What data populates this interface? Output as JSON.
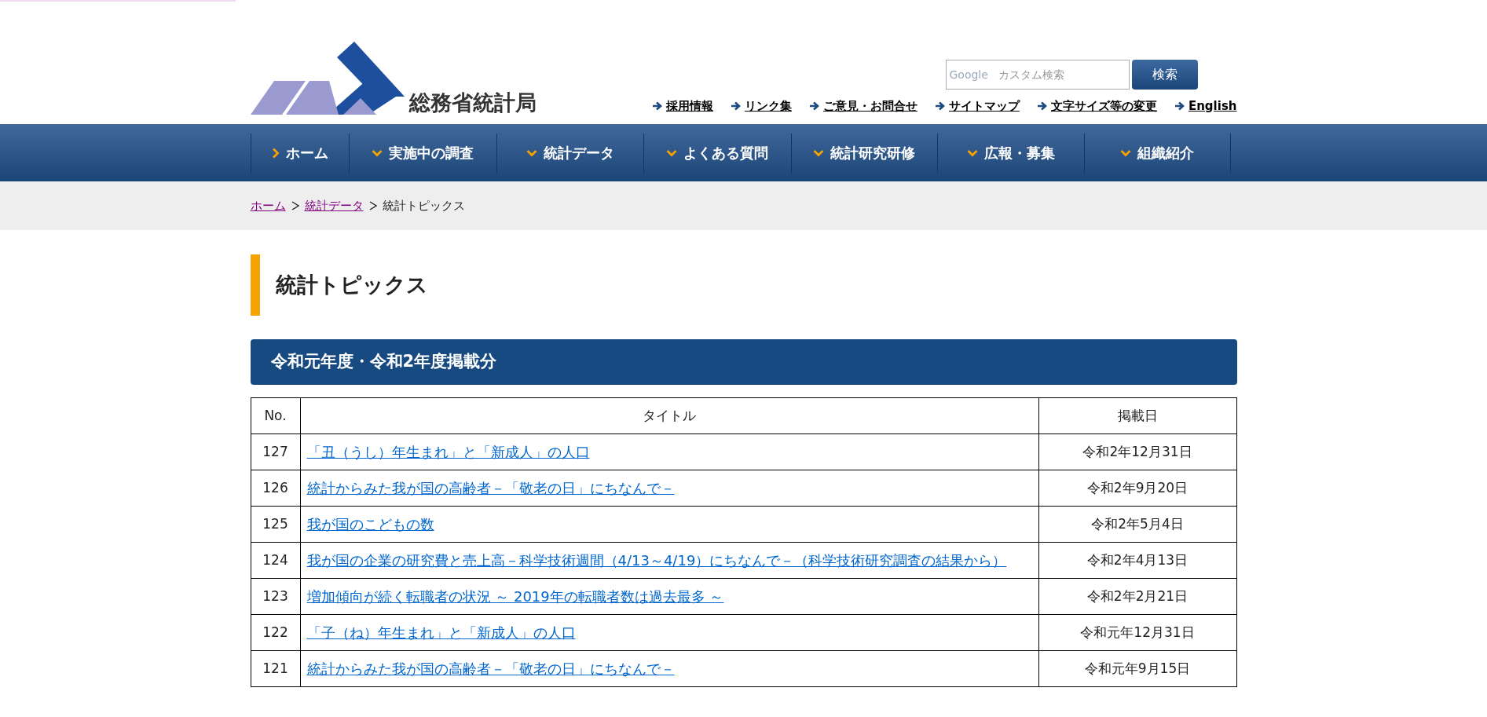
{
  "header": {
    "site_name": "総務省統計局",
    "search": {
      "brand": "Google",
      "placeholder": "カスタム検索",
      "button": "検索"
    },
    "utility_links": [
      "採用情報",
      "リンク集",
      "ご意見・お問合せ",
      "サイトマップ",
      "文字サイズ等の変更",
      "English"
    ]
  },
  "nav": [
    {
      "label": "ホーム",
      "kind": "link"
    },
    {
      "label": "実施中の調査",
      "kind": "menu"
    },
    {
      "label": "統計データ",
      "kind": "menu"
    },
    {
      "label": "よくある質問",
      "kind": "menu"
    },
    {
      "label": "統計研究研修",
      "kind": "menu"
    },
    {
      "label": "広報・募集",
      "kind": "menu"
    },
    {
      "label": "組織紹介",
      "kind": "menu"
    }
  ],
  "breadcrumb": [
    {
      "label": "ホーム",
      "link": true
    },
    {
      "label": "統計データ",
      "link": true
    },
    {
      "label": "統計トピックス",
      "link": false
    }
  ],
  "page_title": "統計トピックス",
  "section_title": "令和元年度・令和2年度掲載分",
  "table": {
    "columns": [
      "No.",
      "タイトル",
      "掲載日"
    ],
    "rows": [
      {
        "no": "127",
        "title": "「丑（うし）年生まれ」と「新成人」の人口",
        "date": "令和2年12月31日"
      },
      {
        "no": "126",
        "title": "統計からみた我が国の高齢者－「敬老の日」にちなんで－",
        "date": "令和2年9月20日"
      },
      {
        "no": "125",
        "title": "我が国のこどもの数",
        "date": "令和2年5月4日"
      },
      {
        "no": "124",
        "title": "我が国の企業の研究費と売上高－科学技術週間（4/13～4/19）にちなんで－（科学技術研究調査の結果から）",
        "date": "令和2年4月13日"
      },
      {
        "no": "123",
        "title": "増加傾向が続く転職者の状況 ～ 2019年の転職者数は過去最多 ～",
        "date": "令和2年2月21日"
      },
      {
        "no": "122",
        "title": "「子（ね）年生まれ」と「新成人」の人口",
        "date": "令和元年12月31日"
      },
      {
        "no": "121",
        "title": "統計からみた我が国の高齢者－「敬老の日」にちなんで－",
        "date": "令和元年9月15日"
      }
    ]
  }
}
